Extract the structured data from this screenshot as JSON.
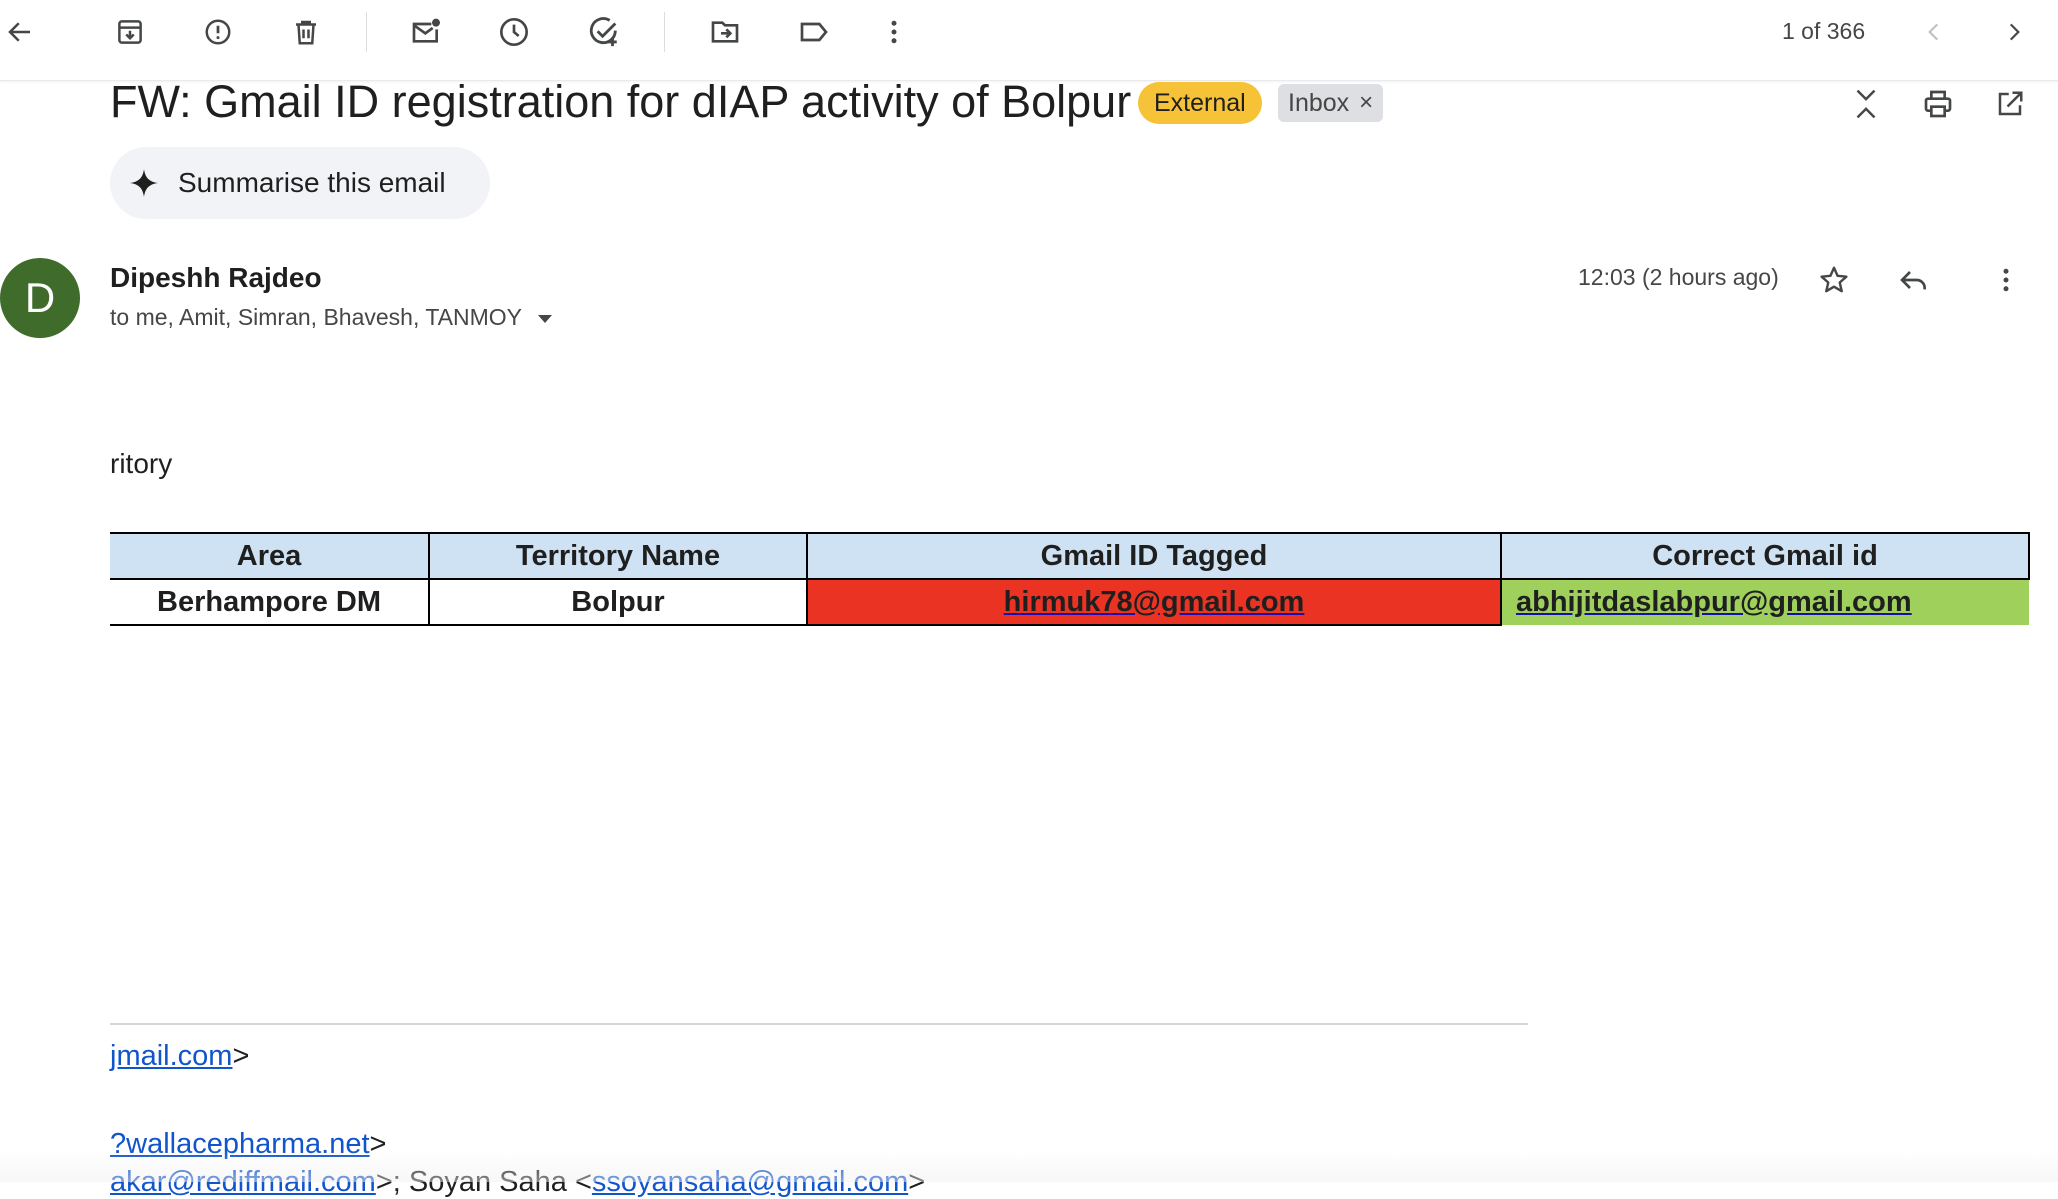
{
  "toolbar": {
    "icons": [
      "back-arrow-icon",
      "archive-icon",
      "report-spam-icon",
      "delete-icon",
      "mark-unread-icon",
      "snooze-icon",
      "add-task-icon",
      "move-to-icon",
      "label-icon",
      "more-vert-icon"
    ],
    "pager_text": "1 of 366"
  },
  "email": {
    "subject": "FW: Gmail ID registration for dIAP activity of Bolpur",
    "labels": {
      "external": "External",
      "inbox": "Inbox",
      "inbox_remove": "×"
    },
    "summarise_label": "Summarise this email",
    "sender": {
      "avatar_letter": "D",
      "avatar_color": "#3f6b2b",
      "name": "Dipeshh Rajdeo"
    },
    "recipients": "to me, Amit, Simran, Bhavesh, TANMOY",
    "timestamp": "12:03 (2 hours ago)",
    "body_snippet": "ritory",
    "table": {
      "headers": [
        "Area",
        "Territory Name",
        "Gmail ID Tagged",
        "Correct Gmail id"
      ],
      "rows": [
        [
          "Berhampore DM",
          "Bolpur",
          "hirmuk78@gmail.com",
          "abhijitdaslabpur@gmail.com"
        ]
      ]
    },
    "quoted": {
      "line1_link": "jmail.com",
      "line1_tail": ">",
      "line2_link": "?wallacepharma.net",
      "line2_tail": ">",
      "line3_link": "akar@rediffmail.com",
      "line3_mid": ">; Soyan Saha <",
      "line3_link2": "ssoyansaha@gmail.com",
      "line3_tail": ">"
    }
  },
  "colors": {
    "external_badge": "#f6c237",
    "header_cell": "#cfe2f3",
    "wrong_cell": "#ea3323",
    "correct_cell": "#9fd05c",
    "link": "#1155cc"
  }
}
